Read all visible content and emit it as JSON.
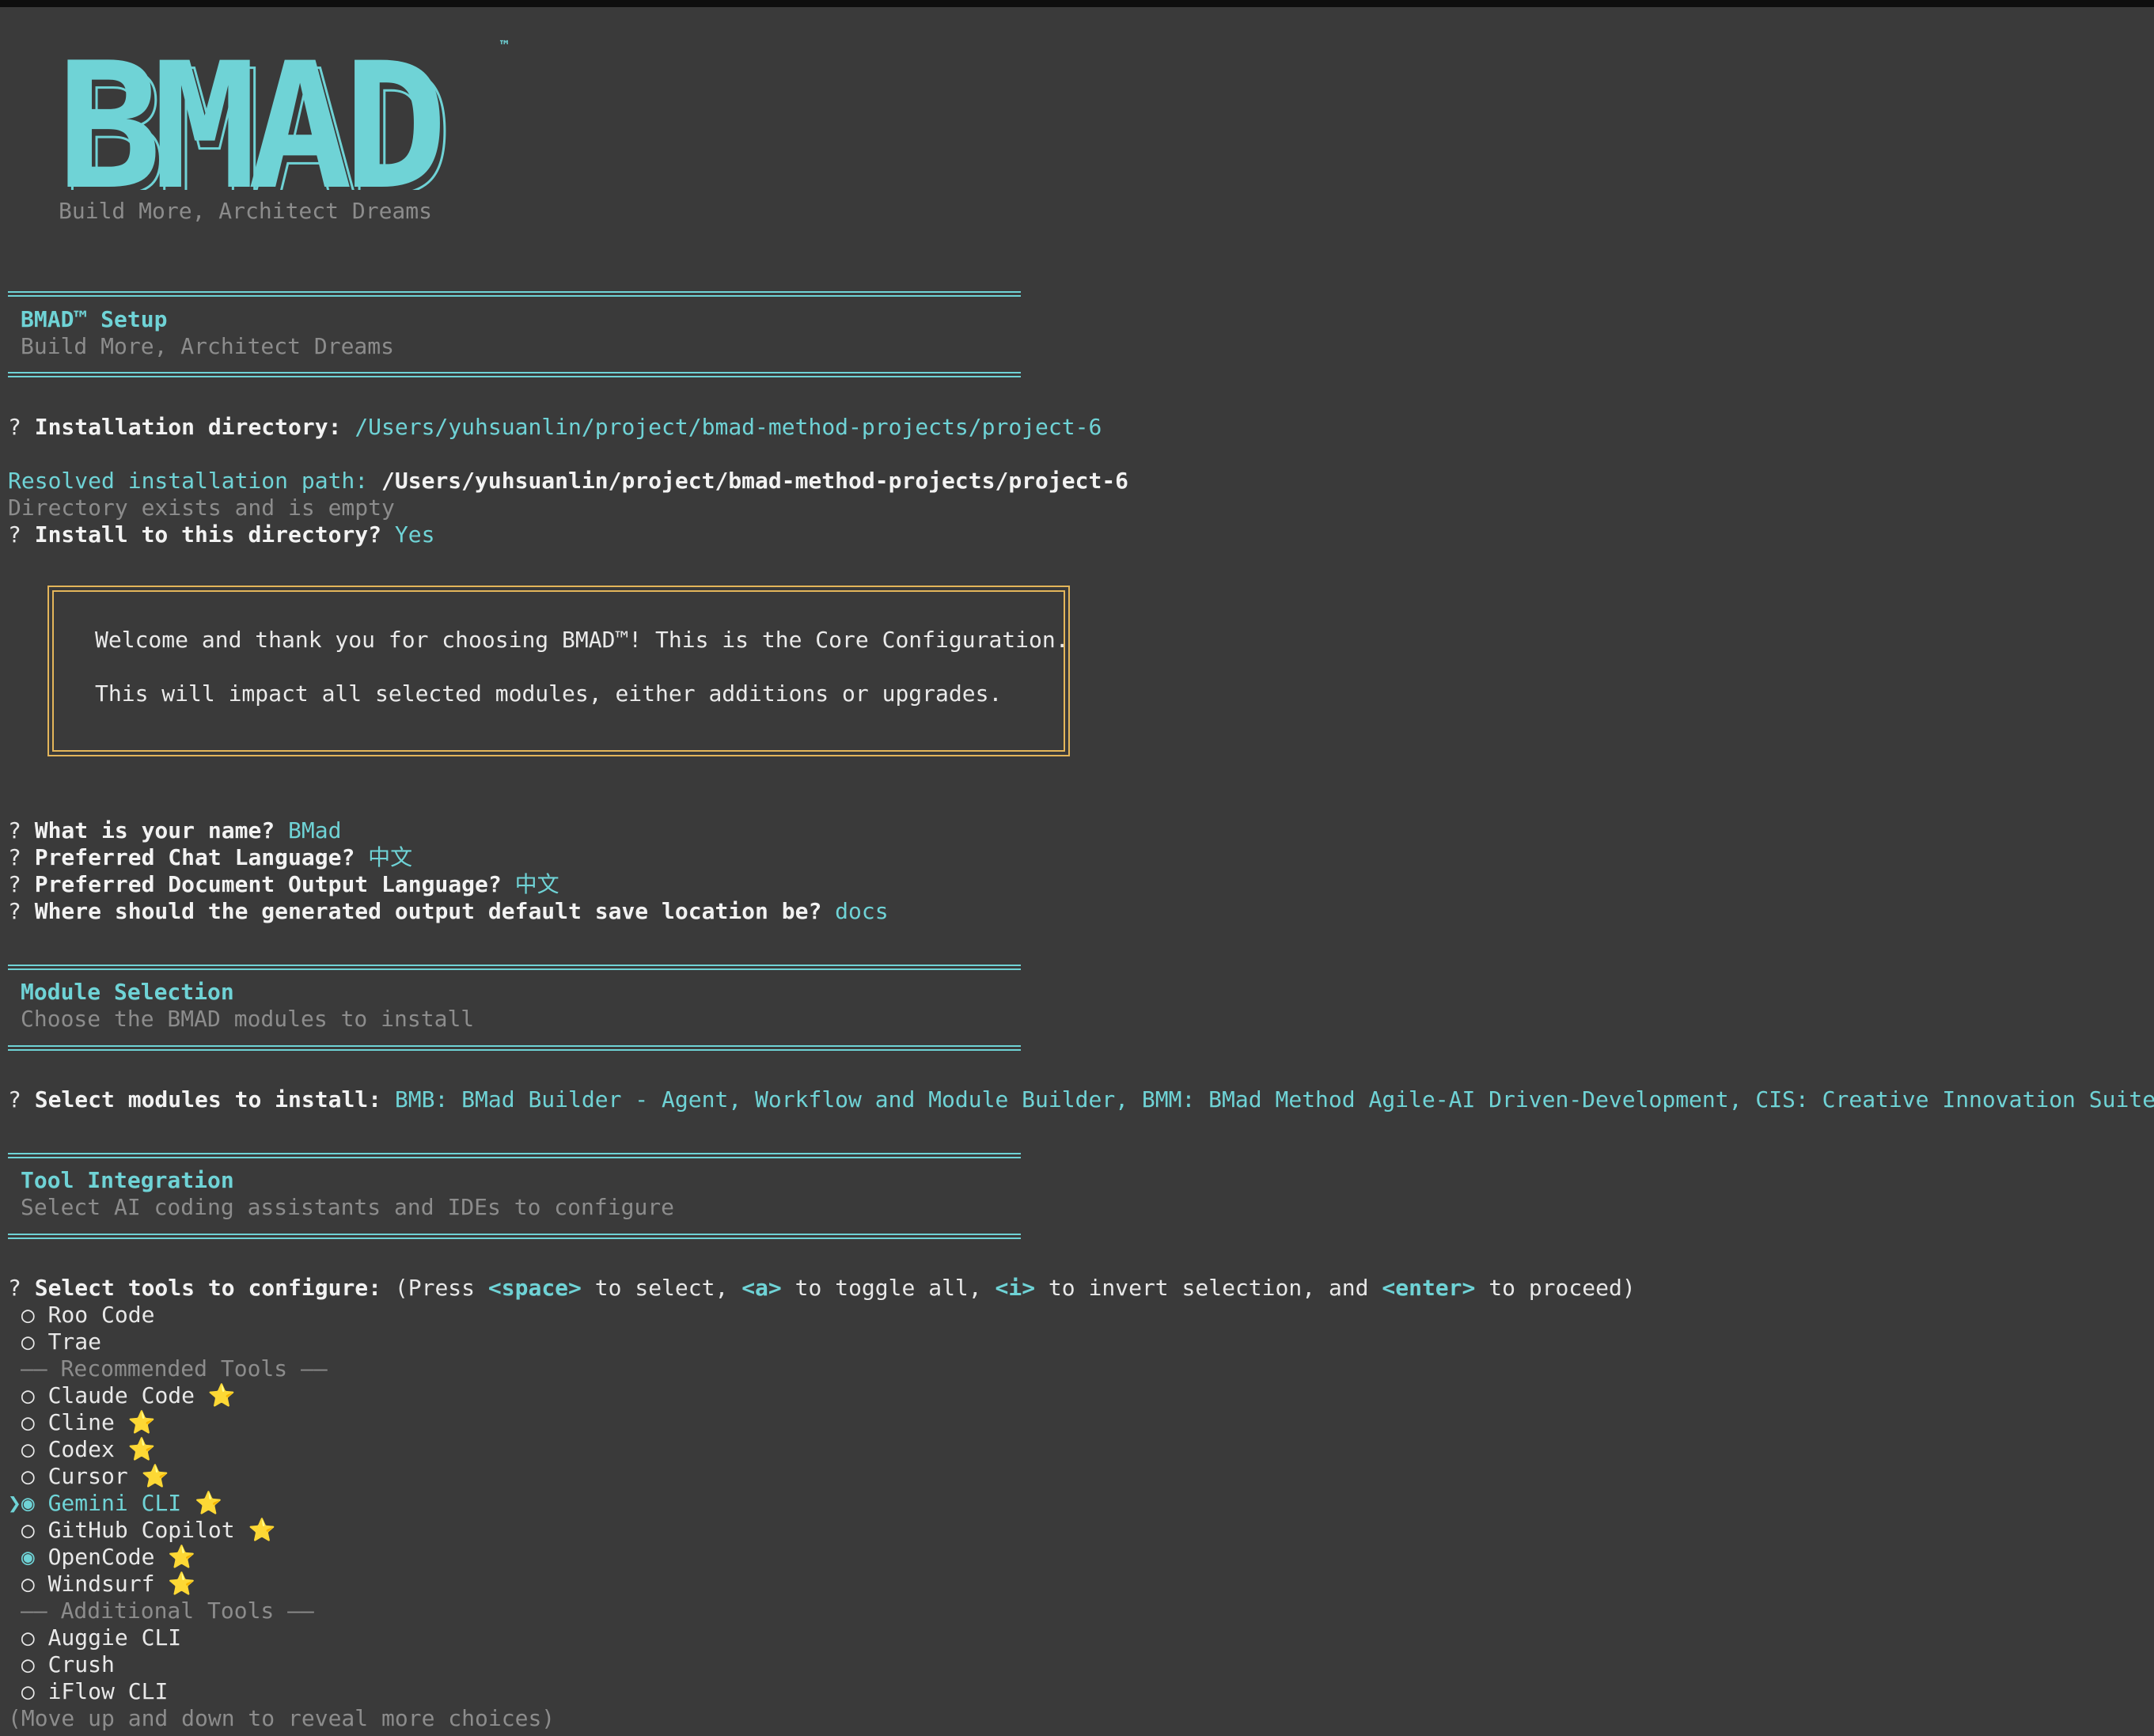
{
  "logo": {
    "text": "BMAD",
    "tm": "™",
    "tagline": "Build More, Architect Dreams"
  },
  "setup": {
    "title": "BMAD™ Setup",
    "subtitle": "Build More, Architect Dreams"
  },
  "install": {
    "q_mark": "?",
    "dir_label": "Installation directory:",
    "dir_value": "/Users/yuhsuanlin/project/bmad-method-projects/project-6",
    "resolved_label": "Resolved installation path:",
    "resolved_value": "/Users/yuhsuanlin/project/bmad-method-projects/project-6",
    "status": "Directory exists and is empty",
    "confirm_label": "Install to this directory?",
    "confirm_value": "Yes"
  },
  "welcome": {
    "line1": "Welcome and thank you for choosing BMAD™! This is the Core Configuration.",
    "line2": "This will impact all selected modules, either additions or upgrades."
  },
  "core": {
    "name_label": "What is your name?",
    "name_value": "BMad",
    "chat_lang_label": "Preferred Chat Language?",
    "chat_lang_value": "中文",
    "doc_lang_label": "Preferred Document Output Language?",
    "doc_lang_value": "中文",
    "output_label": "Where should the generated output default save location be?",
    "output_value": "docs"
  },
  "modules": {
    "title": "Module Selection",
    "subtitle": "Choose the BMAD modules to install",
    "select_label": "Select modules to install:",
    "select_value": "BMB: BMad Builder - Agent, Workflow and Module Builder, BMM: BMad Method Agile-AI Driven-Development, CIS: Creative Innovation Suite"
  },
  "tools": {
    "title": "Tool Integration",
    "subtitle": "Select AI coding assistants and IDEs to configure",
    "prompt_label": "Select tools to configure:",
    "hint_1": "(Press ",
    "key_space": "<space>",
    "hint_2": " to select, ",
    "key_a": "<a>",
    "hint_3": " to toggle all, ",
    "key_i": "<i>",
    "hint_4": " to invert selection, and ",
    "key_enter": "<enter>",
    "hint_5": " to proceed)",
    "recommended_header": "—— Recommended Tools ——",
    "additional_header": "—— Additional Tools ——",
    "footer_hint": "(Move up and down to reveal more choices)",
    "items": [
      {
        "label": "Roo Code",
        "checked": false,
        "star": false,
        "cursor": false
      },
      {
        "label": "Trae",
        "checked": false,
        "star": false,
        "cursor": false
      },
      {
        "label": "Claude Code",
        "checked": false,
        "star": true,
        "cursor": false
      },
      {
        "label": "Cline",
        "checked": false,
        "star": true,
        "cursor": false
      },
      {
        "label": "Codex",
        "checked": false,
        "star": true,
        "cursor": false
      },
      {
        "label": "Cursor",
        "checked": false,
        "star": true,
        "cursor": false
      },
      {
        "label": "Gemini CLI",
        "checked": true,
        "star": true,
        "cursor": true
      },
      {
        "label": "GitHub Copilot",
        "checked": false,
        "star": true,
        "cursor": false
      },
      {
        "label": "OpenCode",
        "checked": true,
        "star": true,
        "cursor": false
      },
      {
        "label": "Windsurf",
        "checked": false,
        "star": true,
        "cursor": false
      },
      {
        "label": "Auggie CLI",
        "checked": false,
        "star": false,
        "cursor": false
      },
      {
        "label": "Crush",
        "checked": false,
        "star": false,
        "cursor": false
      },
      {
        "label": "iFlow CLI",
        "checked": false,
        "star": false,
        "cursor": false
      }
    ],
    "radio_off": "○",
    "radio_on": "◉",
    "pointer": "❯",
    "star_glyph": "⭐"
  },
  "colors": {
    "accent": "#6fd3d6",
    "dim": "#8c8c8c",
    "box_border": "#e3b55a",
    "background": "#3a3a3a"
  }
}
